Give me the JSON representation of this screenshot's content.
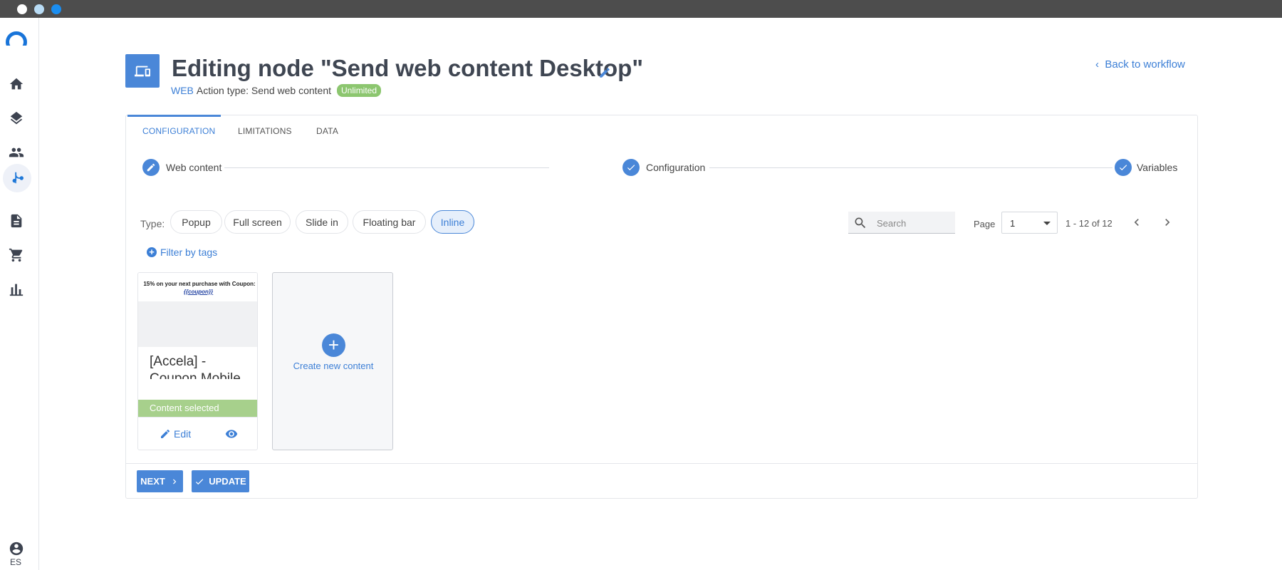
{
  "header": {
    "title": "Editing node \"Send web content Desktop\"",
    "channel": "WEB",
    "action_type": "Action type: Send web content",
    "badge": "Unlimited",
    "back_link": "Back to workflow"
  },
  "sidebar": {
    "items": [
      "home-icon",
      "layers-icon",
      "people-icon",
      "workflow-icon",
      "document-icon",
      "cart-icon",
      "chart-icon"
    ],
    "active": "workflow-icon",
    "language": "ES"
  },
  "tabs": [
    {
      "label": "CONFIGURATION",
      "active": true
    },
    {
      "label": "LIMITATIONS",
      "active": false
    },
    {
      "label": "DATA",
      "active": false
    }
  ],
  "stepper": [
    {
      "label": "Web content",
      "state": "editing"
    },
    {
      "label": "Configuration",
      "state": "done"
    },
    {
      "label": "Variables",
      "state": "done"
    }
  ],
  "types": {
    "label": "Type:",
    "options": [
      {
        "label": "Popup",
        "active": false
      },
      {
        "label": "Full screen",
        "active": false
      },
      {
        "label": "Slide in",
        "active": false
      },
      {
        "label": "Floating bar",
        "active": false
      },
      {
        "label": "Inline",
        "active": true
      }
    ]
  },
  "search": {
    "placeholder": "Search",
    "value": ""
  },
  "pagination": {
    "label": "Page",
    "current": "1",
    "range": "1 - 12 of 12"
  },
  "filter": {
    "label": "Filter by tags"
  },
  "content_card": {
    "preview_text": "15% on your next purchase with Coupon:",
    "preview_code": "{{coupon}}",
    "name": "[Accela] - Coupon Mobile",
    "status": "Content selected",
    "edit_label": "Edit"
  },
  "create_card": {
    "label": "Create new content"
  },
  "actions": {
    "next_label": "NEXT",
    "update_label": "UPDATE"
  },
  "colors": {
    "accent": "#4a87d8",
    "link": "#3c7fd6",
    "badge": "#8cc66f",
    "selected": "#a7d08c"
  }
}
